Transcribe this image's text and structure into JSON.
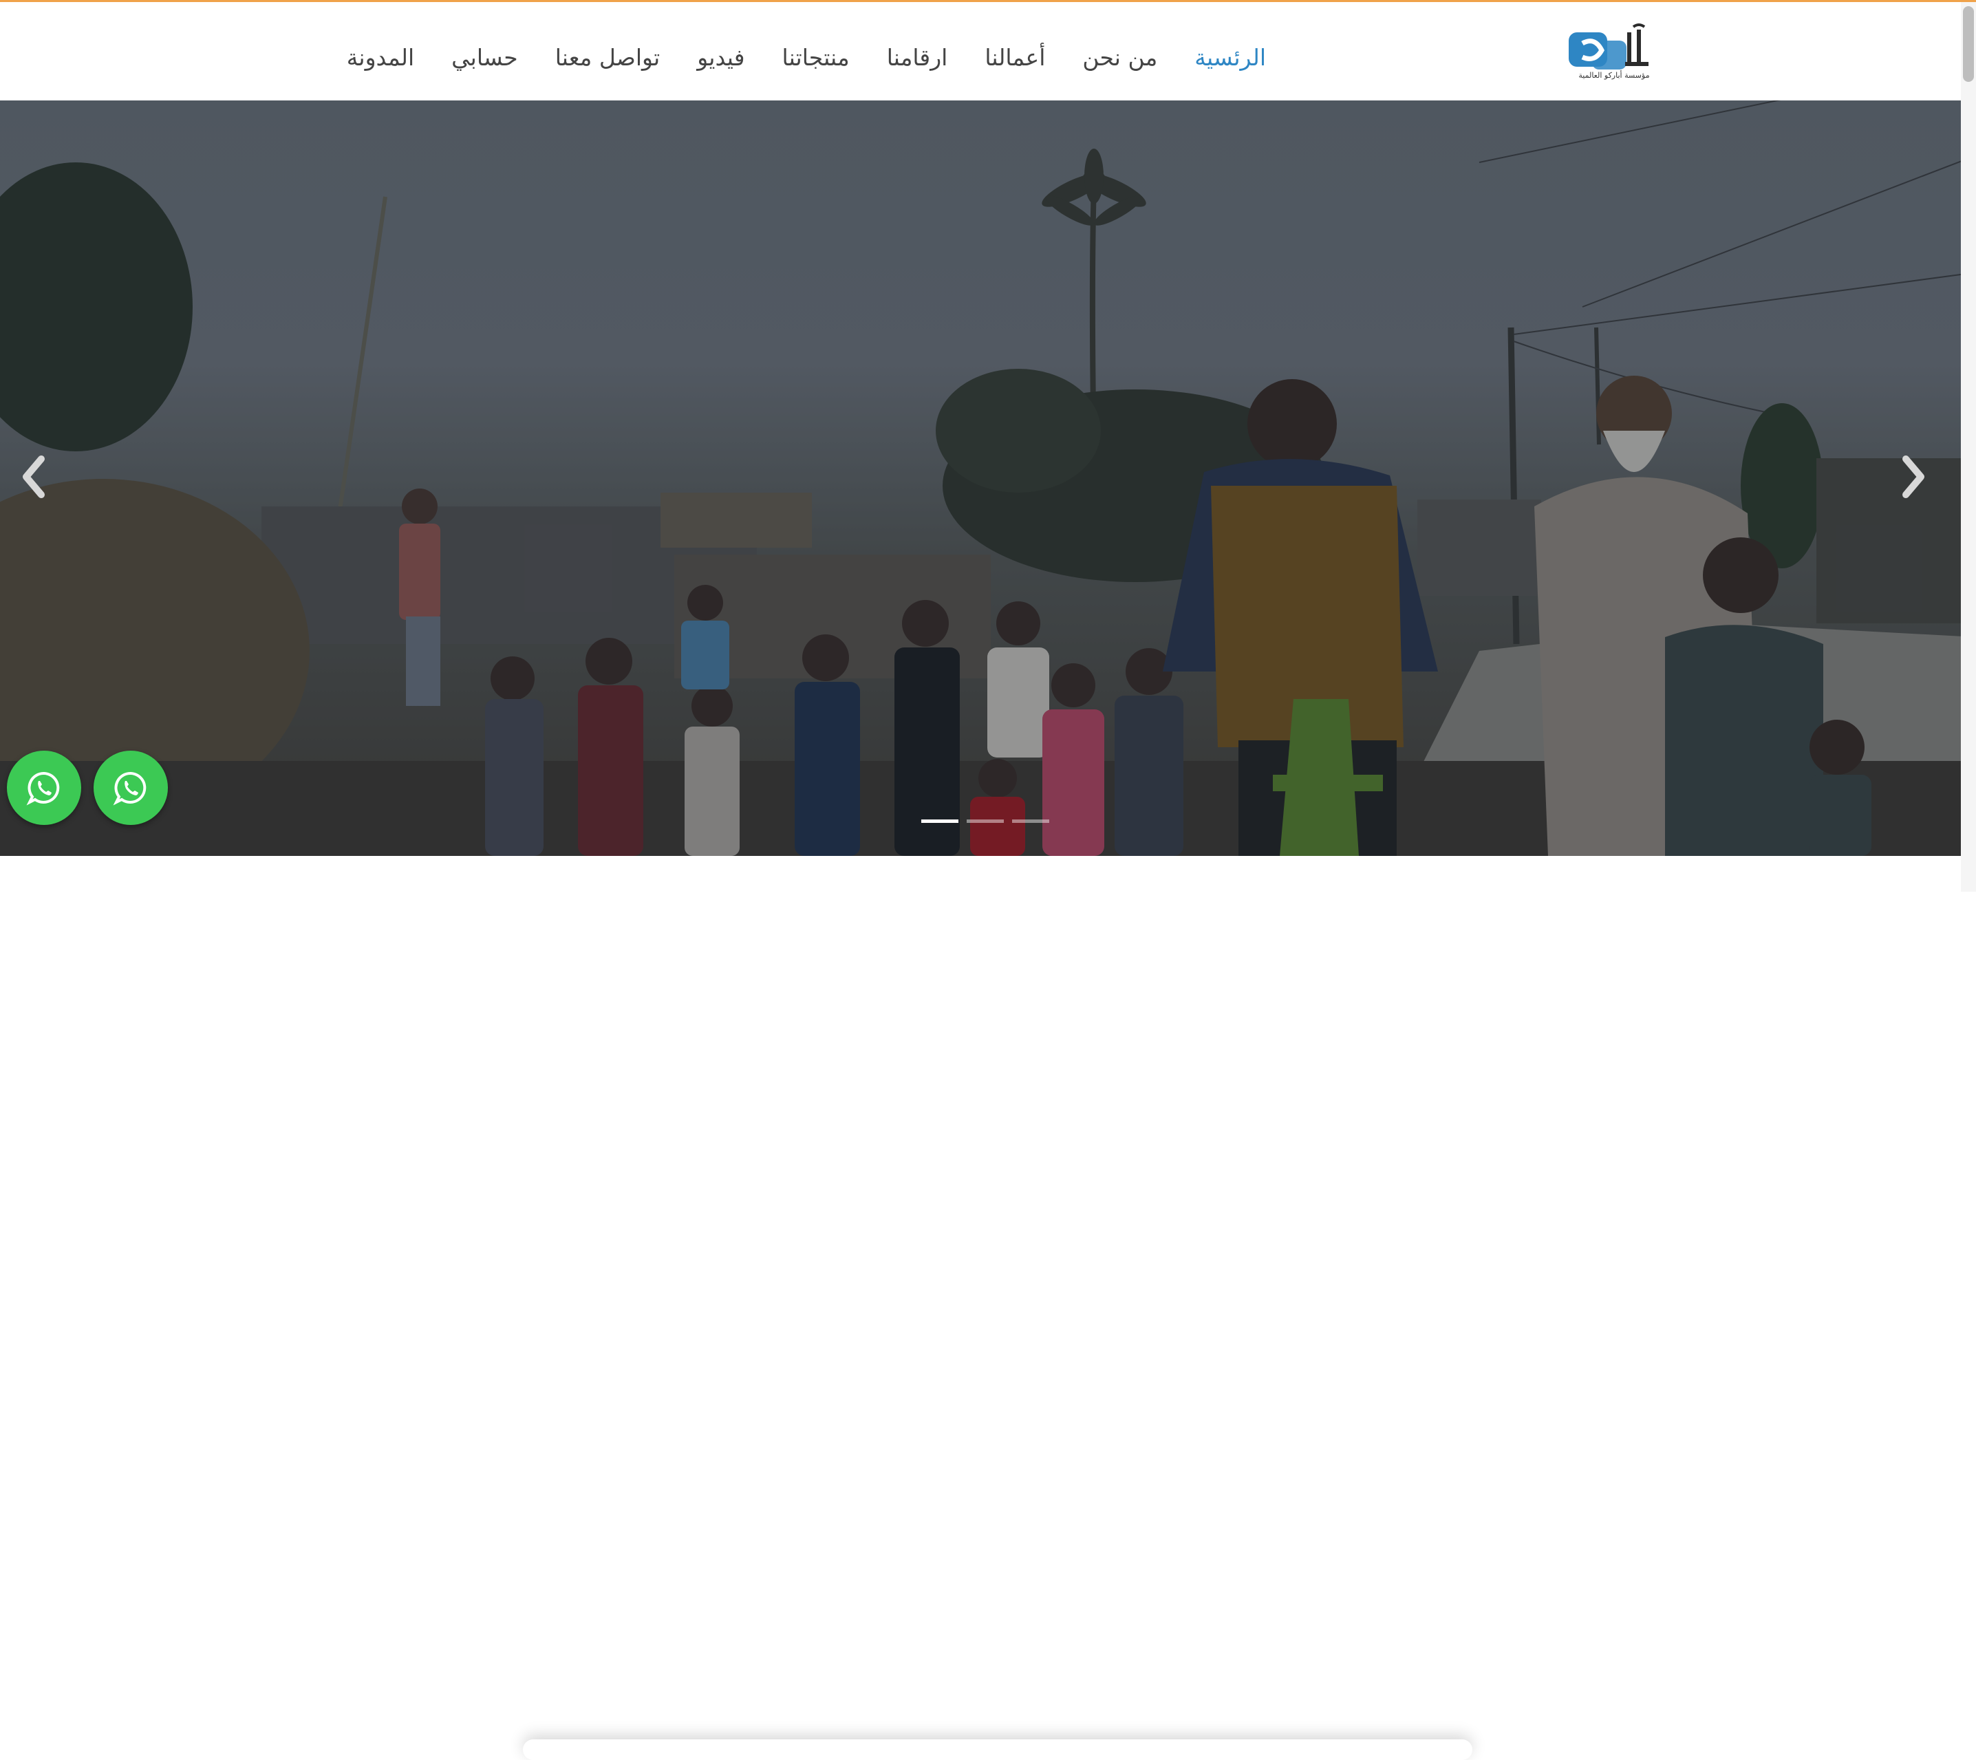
{
  "brand": {
    "logo_text": "آباركو",
    "logo_subtitle": "مؤسسة أباركو العالمية",
    "logo_colors": {
      "blue": "#2e86c4",
      "dark": "#2b2b2b"
    }
  },
  "nav": {
    "items": [
      {
        "label": "الرئسية",
        "active": true
      },
      {
        "label": "من نحن",
        "active": false
      },
      {
        "label": "أعمالنا",
        "active": false
      },
      {
        "label": "ارقامنا",
        "active": false
      },
      {
        "label": "منتجاتنا",
        "active": false
      },
      {
        "label": "فيديو",
        "active": false
      },
      {
        "label": "تواصل معنا",
        "active": false
      },
      {
        "label": "حسابي",
        "active": false
      },
      {
        "label": "المدونة",
        "active": false
      }
    ],
    "active_color": "#2e86c4",
    "text_color": "#444444"
  },
  "hero": {
    "slides_count": 3,
    "active_slide": 1,
    "prev_icon": "chevron-left-icon",
    "next_icon": "chevron-right-icon"
  },
  "floating": {
    "buttons": [
      {
        "icon": "whatsapp-icon"
      },
      {
        "icon": "whatsapp-icon"
      }
    ],
    "color": "#3cc954"
  },
  "accent_top_border": "#f0a24a"
}
